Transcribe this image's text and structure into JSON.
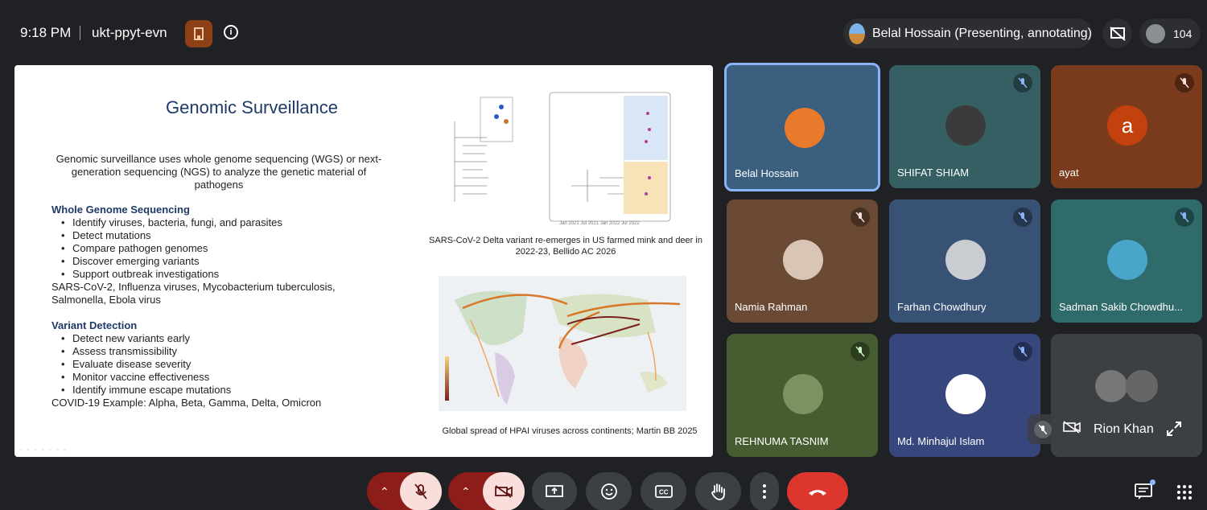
{
  "top": {
    "time": "9:18 PM",
    "meeting_code": "ukt-ppyt-evn",
    "presenter_label": "Belal Hossain (Presenting, annotating)",
    "participant_count": "104"
  },
  "slide": {
    "title": "Genomic Surveillance",
    "intro": "Genomic surveillance uses whole genome sequencing (WGS) or next-generation sequencing (NGS) to analyze the genetic material of pathogens",
    "section1_title": "Whole Genome Sequencing",
    "section1_items": [
      "Identify viruses, bacteria, fungi, and parasites",
      "Detect mutations",
      "Compare pathogen genomes",
      "Discover emerging variants",
      "Support outbreak investigations"
    ],
    "section1_note": "SARS-CoV-2, Influenza viruses, Mycobacterium tuberculosis, Salmonella, Ebola virus",
    "section2_title": "Variant Detection",
    "section2_items": [
      "Detect new variants early",
      "Assess transmissibility",
      "Evaluate disease severity",
      "Monitor vaccine effectiveness",
      "Identify immune escape mutations"
    ],
    "section2_note": "COVID-19 Example: Alpha, Beta, Gamma, Delta, Omicron",
    "figure1_caption": "SARS-CoV-2 Delta variant re-emerges in US farmed mink and deer in 2022-23, Bellido AC 2026",
    "figure2_caption": "Global spread of HPAI viruses across continents; Martin BB 2025"
  },
  "tiles": [
    {
      "name": "Belal Hossain",
      "bg": "#3b5f7f",
      "photo": "#e87a2c"
    },
    {
      "name": "SHIFAT SHIAM",
      "bg": "#355f63",
      "photo": "#3a3b3d"
    },
    {
      "name": "ayat",
      "bg": "#7a3a1c",
      "letter": "a",
      "photo": "#c2410c"
    },
    {
      "name": "Namia Rahman",
      "bg": "#6b4a35",
      "photo": "#d8c5b5"
    },
    {
      "name": "Farhan Chowdhury",
      "bg": "#385276",
      "photo": "#c9ccd1"
    },
    {
      "name": "Sadman Sakib Chowdhu...",
      "bg": "#2f6b6b",
      "photo": "#49a5c9"
    },
    {
      "name": "REHNUMA TASNIM",
      "bg": "#465d31",
      "photo": "#7b9361"
    },
    {
      "name": "Md. Minhajul Islam",
      "bg": "#37477e",
      "photo": "#ffffff"
    },
    {
      "name": "Rion Khan",
      "bg": "#3c4043",
      "photo": "#777"
    }
  ],
  "selfview": {
    "name": "Rion Khan"
  },
  "icons": [
    "building-icon",
    "info-icon",
    "present-off-icon",
    "mic-off-icon",
    "cam-off-icon",
    "present-icon",
    "emoji-icon",
    "captions-icon",
    "raise-hand-icon",
    "more-icon",
    "hangup-icon",
    "chat-icon",
    "apps-icon",
    "expand-icon"
  ]
}
